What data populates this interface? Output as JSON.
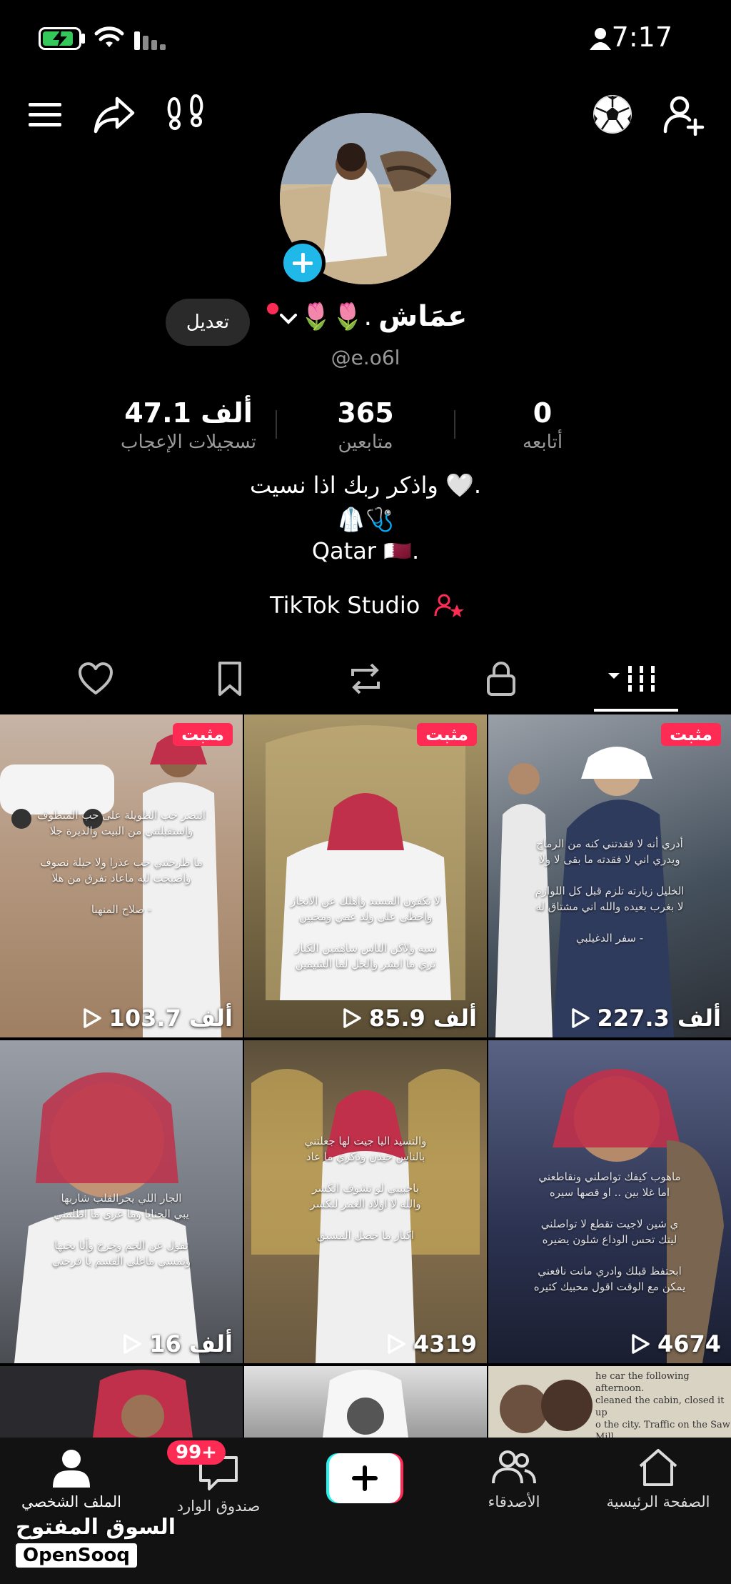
{
  "status_bar": {
    "time": "7:17"
  },
  "profile": {
    "name": "عمَاش",
    "name_decor": "🌷🌷.",
    "username": "@e.o6l",
    "edit_label": "تعديل",
    "stats": [
      {
        "value": "0",
        "label": "أتابعه"
      },
      {
        "value": "365",
        "label": "متابعين"
      },
      {
        "value": "47.1 ألف",
        "label": "تسجيلات الإعجاب"
      }
    ],
    "bio_lines": [
      "واذكر ربك اذا نسيت 🤍.",
      "🥼🩺",
      "Qatar 🇶🇦."
    ],
    "studio_label": "TikTok Studio"
  },
  "tabs": [
    "heart-icon",
    "bookmark-icon",
    "repost-icon",
    "lock-icon",
    "grid-icon"
  ],
  "videos": [
    {
      "views": "227.3 ألف",
      "pinned": true,
      "pin_label": "مثبت",
      "color": "#6a6f78"
    },
    {
      "views": "85.9 ألف",
      "pinned": true,
      "pin_label": "مثبت",
      "color": "#8a7a52"
    },
    {
      "views": "103.7 ألف",
      "pinned": true,
      "pin_label": "مثبت",
      "color": "#b59a7d"
    },
    {
      "views": "4674",
      "pinned": false,
      "color": "#394463"
    },
    {
      "views": "4319",
      "pinned": false,
      "color": "#6b5a40"
    },
    {
      "views": "16 ألف",
      "pinned": false,
      "color": "#7b7d85"
    },
    {
      "views": "",
      "pinned": false,
      "color": "#cfc9bb"
    },
    {
      "views": "",
      "pinned": false,
      "color": "#bdbdbd"
    },
    {
      "views": "",
      "pinned": false,
      "color": "#3b3b40"
    }
  ],
  "nav": {
    "profile": "الملف الشخصي",
    "inbox": "صندوق الوارد",
    "inbox_badge": "99+",
    "friends": "الأصدقاء",
    "home": "الصفحة الرئيسية"
  },
  "watermark": {
    "arabic": "السوق المفتوح",
    "english": "OpenSooq"
  }
}
